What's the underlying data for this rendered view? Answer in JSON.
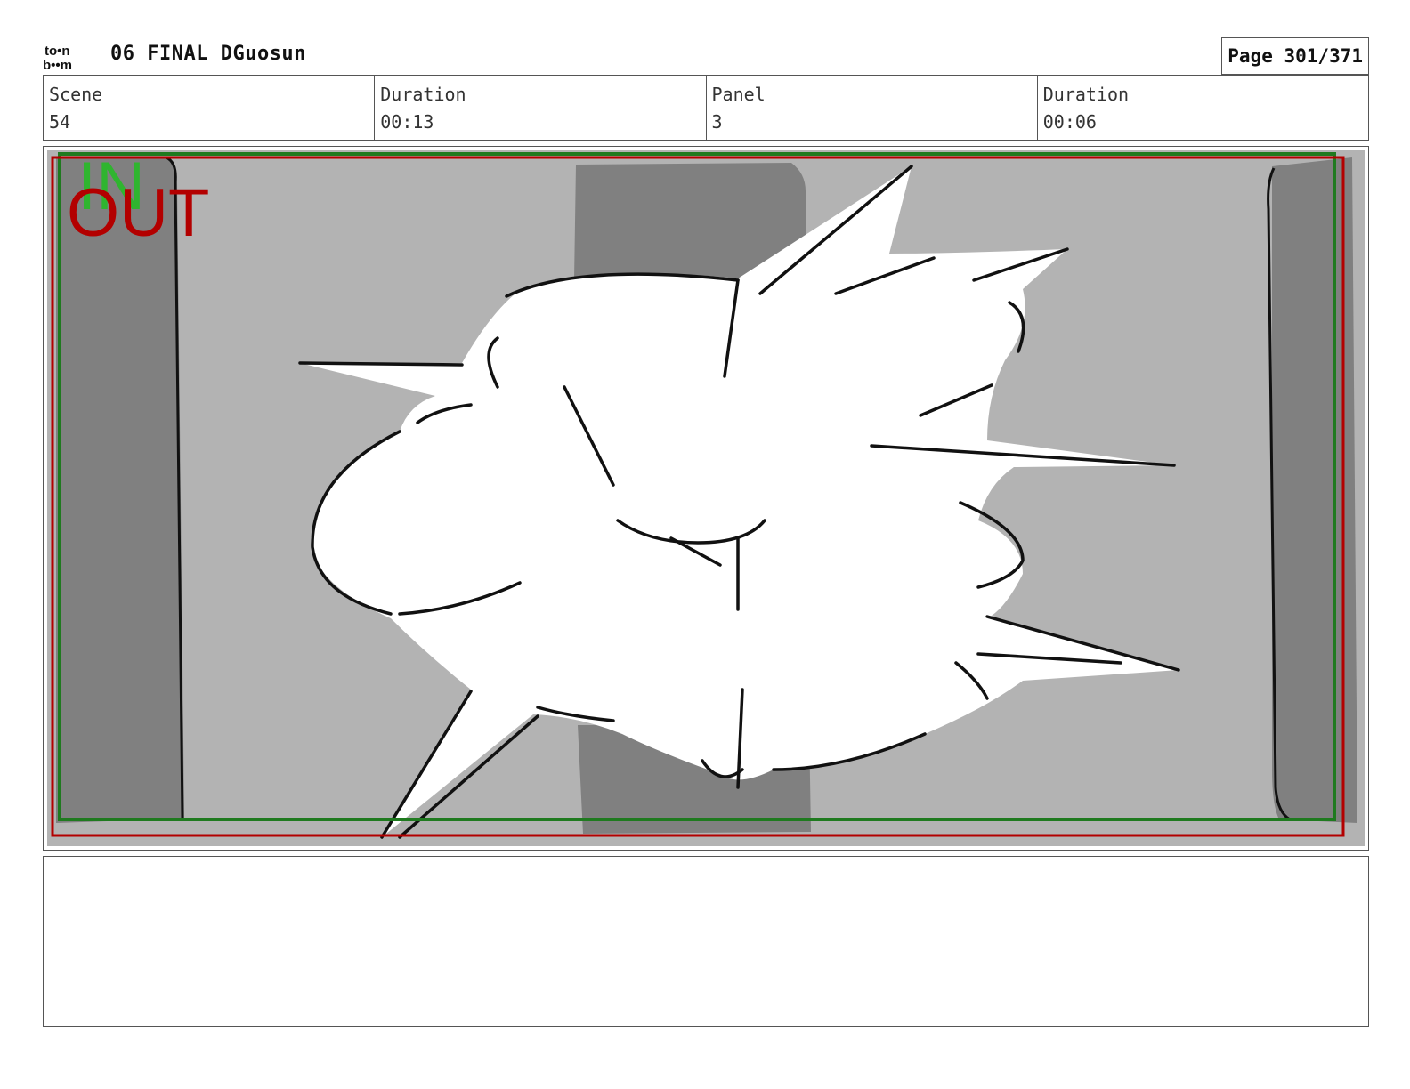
{
  "header": {
    "logo_top": "to•n",
    "logo_bottom": "b••m",
    "title": "06 FINAL DGuosun",
    "page_label": "Page 301/371"
  },
  "info": {
    "scene_label": "Scene",
    "scene_value": "54",
    "scene_duration_label": "Duration",
    "scene_duration_value": "00:13",
    "panel_label": "Panel",
    "panel_value": "3",
    "panel_duration_label": "Duration",
    "panel_duration_value": "00:06"
  },
  "panel": {
    "marker_in": "IN",
    "marker_out": "OUT",
    "colors": {
      "background_gray": "#b3b3b3",
      "pillar_gray": "#808080",
      "safe_frame_green": "#1f7a1f",
      "camera_frame_red": "#b30000",
      "in_marker_green": "#2fb52f",
      "out_marker_red": "#b30000"
    }
  },
  "caption": {
    "text": ""
  }
}
